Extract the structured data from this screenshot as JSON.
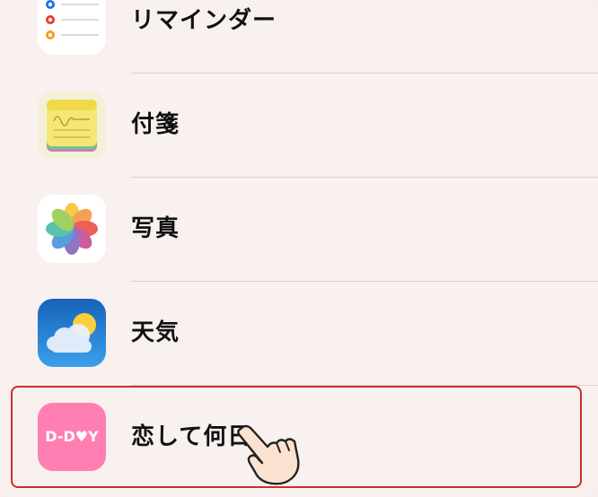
{
  "apps": [
    {
      "id": "reminders",
      "label": "リマインダー",
      "icon": "reminders-icon"
    },
    {
      "id": "stickies",
      "label": "付箋",
      "icon": "stickies-icon"
    },
    {
      "id": "photos",
      "label": "写真",
      "icon": "photos-icon"
    },
    {
      "id": "weather",
      "label": "天気",
      "icon": "weather-icon"
    },
    {
      "id": "dday",
      "label": "恋して何日",
      "icon": "dday-icon",
      "icon_text": "D-D♥Y",
      "selected": true
    }
  ],
  "colors": {
    "highlight": "#d32b2b",
    "dday_bg": "#ff7fb3",
    "weather_bg": "#1f74c9"
  }
}
